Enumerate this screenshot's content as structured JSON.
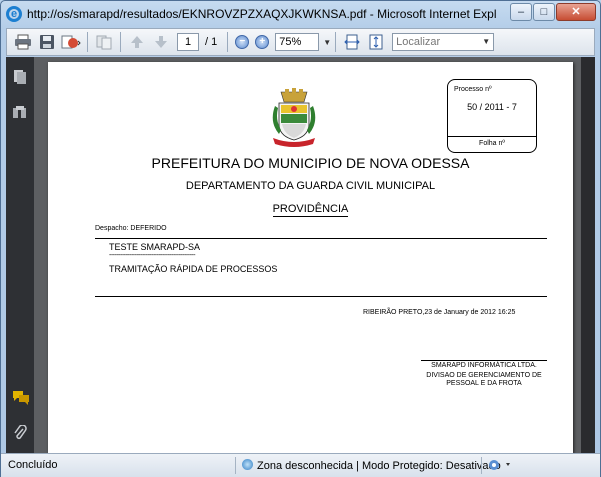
{
  "window": {
    "title": "http://os/smarapd/resultados/EKNROVZPZXAQXJKWKNSA.pdf - Microsoft Internet Explorer fornecido por SMARapd",
    "min_label": "–",
    "max_label": "□",
    "close_label": "✕"
  },
  "toolbar": {
    "page_current": "1",
    "page_total": "/ 1",
    "zoom_value": "75%",
    "search_placeholder": "Localizar",
    "zoom_out_label": "−",
    "zoom_in_label": "+"
  },
  "document": {
    "processo_label": "Processo nº",
    "processo_number": "50 / 2011 - 7",
    "folha_label": "Folha nº",
    "title": "PREFEITURA DO MUNICIPIO DE NOVA ODESSA",
    "department": "DEPARTAMENTO DA GUARDA CIVIL MUNICIPAL",
    "heading": "PROVIDÊNCIA",
    "despacho": "Despacho:  DEFERIDO",
    "text_line1": "TESTE SMARAPD-SA",
    "dashes": "-----------------------------------------------",
    "text_line2": "TRAMITAÇÃO RÁPIDA DE PROCESSOS",
    "date_line": "RIBEIRÃO PRETO,23 de January de 2012 16:25",
    "signature_company": "SMARAPD INFORMÁTICA LTDA.",
    "signature_division": "DIVISAO DE GERENCIAMENTO DE PESSOAL E DA FROTA"
  },
  "statusbar": {
    "status": "Concluído",
    "zone": "Zona desconhecida | Modo Protegido: Desativado"
  },
  "colors": {
    "frame": "#b9d1ea",
    "viewer_bg": "#5d5f62",
    "left_panel": "#2e3034"
  }
}
